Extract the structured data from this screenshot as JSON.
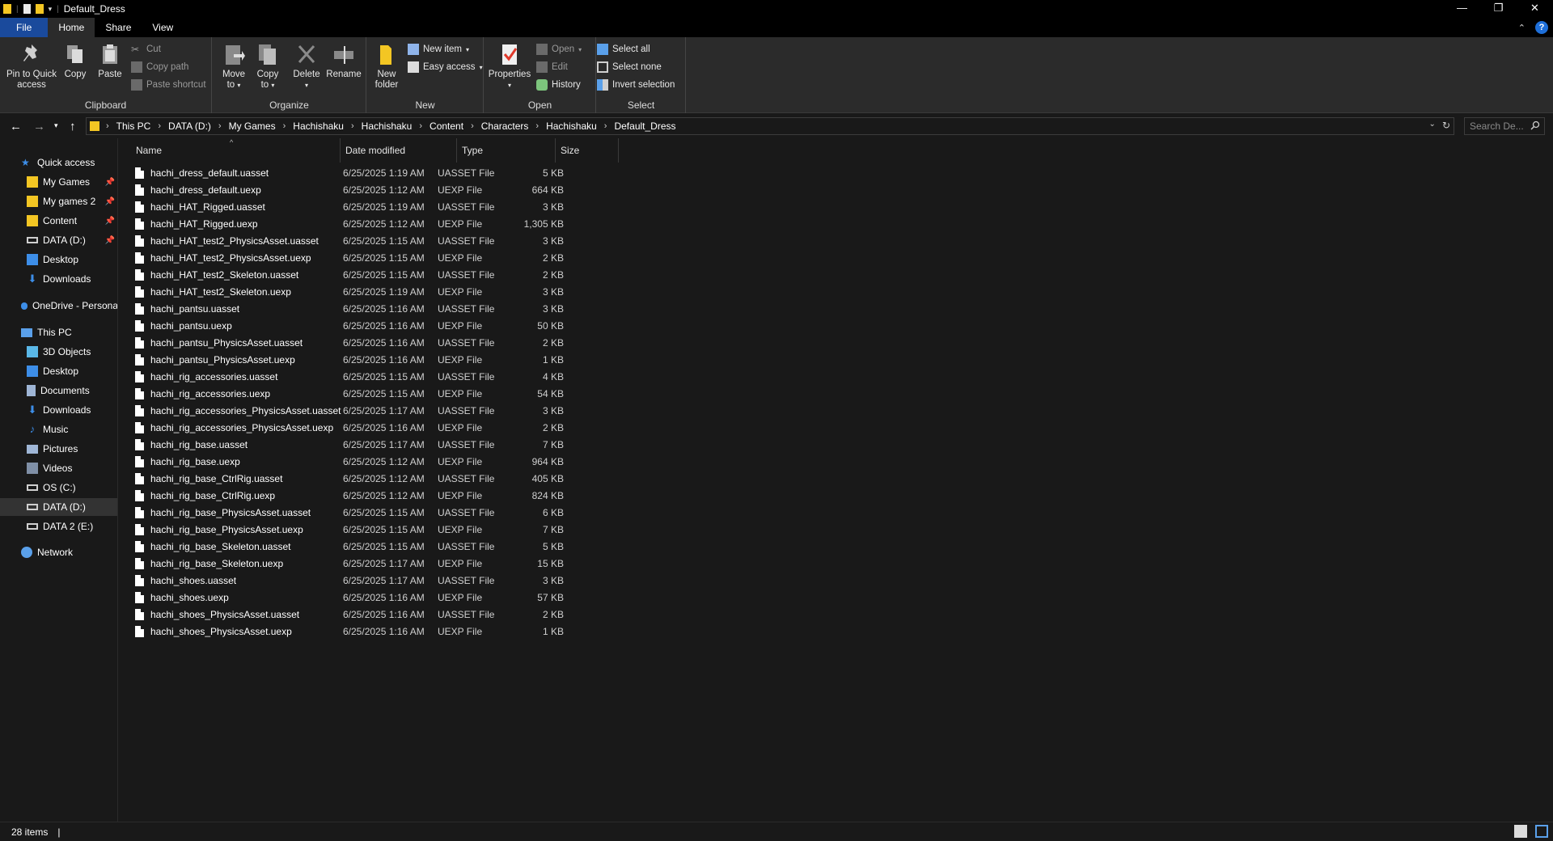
{
  "window": {
    "title": "Default_Dress",
    "minimize": "—",
    "restore": "❐",
    "close": "✕"
  },
  "ribbon_tabs": [
    "File",
    "Home",
    "Share",
    "View"
  ],
  "ribbon": {
    "clipboard": {
      "label": "Clipboard",
      "pin_label_1": "Pin to Quick",
      "pin_label_2": "access",
      "copy": "Copy",
      "paste": "Paste",
      "cut": "Cut",
      "copy_path": "Copy path",
      "paste_shortcut": "Paste shortcut"
    },
    "organize": {
      "label": "Organize",
      "move_to_1": "Move",
      "move_to_2": "to",
      "copy_to_1": "Copy",
      "copy_to_2": "to",
      "delete": "Delete",
      "rename": "Rename"
    },
    "new": {
      "label": "New",
      "new_folder_1": "New",
      "new_folder_2": "folder",
      "new_item": "New item",
      "easy_access": "Easy access"
    },
    "open": {
      "label": "Open",
      "properties": "Properties",
      "open": "Open",
      "edit": "Edit",
      "history": "History"
    },
    "select": {
      "label": "Select",
      "select_all": "Select all",
      "select_none": "Select none",
      "invert_selection": "Invert selection"
    }
  },
  "address": {
    "crumbs": [
      "This PC",
      "DATA (D:)",
      "My Games",
      "Hachishaku",
      "Hachishaku",
      "Content",
      "Characters",
      "Hachishaku",
      "Default_Dress"
    ],
    "search_placeholder": "Search De..."
  },
  "nav": {
    "quick_access": "Quick access",
    "pinned": [
      "My Games",
      "My games 2",
      "Content",
      "DATA (D:)"
    ],
    "recent": [
      "Desktop",
      "Downloads"
    ],
    "onedrive": "OneDrive - Persona",
    "this_pc": "This PC",
    "pc_items": [
      "3D Objects",
      "Desktop",
      "Documents",
      "Downloads",
      "Music",
      "Pictures",
      "Videos",
      "OS (C:)",
      "DATA (D:)",
      "DATA 2 (E:)"
    ],
    "network": "Network"
  },
  "columns": [
    "Name",
    "Date modified",
    "Type",
    "Size"
  ],
  "files": [
    {
      "name": "hachi_dress_default.uasset",
      "date": "6/25/2025 1:19 AM",
      "type": "UASSET File",
      "size": "5 KB"
    },
    {
      "name": "hachi_dress_default.uexp",
      "date": "6/25/2025 1:12 AM",
      "type": "UEXP File",
      "size": "664 KB"
    },
    {
      "name": "hachi_HAT_Rigged.uasset",
      "date": "6/25/2025 1:19 AM",
      "type": "UASSET File",
      "size": "3 KB"
    },
    {
      "name": "hachi_HAT_Rigged.uexp",
      "date": "6/25/2025 1:12 AM",
      "type": "UEXP File",
      "size": "1,305 KB"
    },
    {
      "name": "hachi_HAT_test2_PhysicsAsset.uasset",
      "date": "6/25/2025 1:15 AM",
      "type": "UASSET File",
      "size": "3 KB"
    },
    {
      "name": "hachi_HAT_test2_PhysicsAsset.uexp",
      "date": "6/25/2025 1:15 AM",
      "type": "UEXP File",
      "size": "2 KB"
    },
    {
      "name": "hachi_HAT_test2_Skeleton.uasset",
      "date": "6/25/2025 1:15 AM",
      "type": "UASSET File",
      "size": "2 KB"
    },
    {
      "name": "hachi_HAT_test2_Skeleton.uexp",
      "date": "6/25/2025 1:19 AM",
      "type": "UEXP File",
      "size": "3 KB"
    },
    {
      "name": "hachi_pantsu.uasset",
      "date": "6/25/2025 1:16 AM",
      "type": "UASSET File",
      "size": "3 KB"
    },
    {
      "name": "hachi_pantsu.uexp",
      "date": "6/25/2025 1:16 AM",
      "type": "UEXP File",
      "size": "50 KB"
    },
    {
      "name": "hachi_pantsu_PhysicsAsset.uasset",
      "date": "6/25/2025 1:16 AM",
      "type": "UASSET File",
      "size": "2 KB"
    },
    {
      "name": "hachi_pantsu_PhysicsAsset.uexp",
      "date": "6/25/2025 1:16 AM",
      "type": "UEXP File",
      "size": "1 KB"
    },
    {
      "name": "hachi_rig_accessories.uasset",
      "date": "6/25/2025 1:15 AM",
      "type": "UASSET File",
      "size": "4 KB"
    },
    {
      "name": "hachi_rig_accessories.uexp",
      "date": "6/25/2025 1:15 AM",
      "type": "UEXP File",
      "size": "54 KB"
    },
    {
      "name": "hachi_rig_accessories_PhysicsAsset.uasset",
      "date": "6/25/2025 1:17 AM",
      "type": "UASSET File",
      "size": "3 KB"
    },
    {
      "name": "hachi_rig_accessories_PhysicsAsset.uexp",
      "date": "6/25/2025 1:16 AM",
      "type": "UEXP File",
      "size": "2 KB"
    },
    {
      "name": "hachi_rig_base.uasset",
      "date": "6/25/2025 1:17 AM",
      "type": "UASSET File",
      "size": "7 KB"
    },
    {
      "name": "hachi_rig_base.uexp",
      "date": "6/25/2025 1:12 AM",
      "type": "UEXP File",
      "size": "964 KB"
    },
    {
      "name": "hachi_rig_base_CtrlRig.uasset",
      "date": "6/25/2025 1:12 AM",
      "type": "UASSET File",
      "size": "405 KB"
    },
    {
      "name": "hachi_rig_base_CtrlRig.uexp",
      "date": "6/25/2025 1:12 AM",
      "type": "UEXP File",
      "size": "824 KB"
    },
    {
      "name": "hachi_rig_base_PhysicsAsset.uasset",
      "date": "6/25/2025 1:15 AM",
      "type": "UASSET File",
      "size": "6 KB"
    },
    {
      "name": "hachi_rig_base_PhysicsAsset.uexp",
      "date": "6/25/2025 1:15 AM",
      "type": "UEXP File",
      "size": "7 KB"
    },
    {
      "name": "hachi_rig_base_Skeleton.uasset",
      "date": "6/25/2025 1:15 AM",
      "type": "UASSET File",
      "size": "5 KB"
    },
    {
      "name": "hachi_rig_base_Skeleton.uexp",
      "date": "6/25/2025 1:17 AM",
      "type": "UEXP File",
      "size": "15 KB"
    },
    {
      "name": "hachi_shoes.uasset",
      "date": "6/25/2025 1:17 AM",
      "type": "UASSET File",
      "size": "3 KB"
    },
    {
      "name": "hachi_shoes.uexp",
      "date": "6/25/2025 1:16 AM",
      "type": "UEXP File",
      "size": "57 KB"
    },
    {
      "name": "hachi_shoes_PhysicsAsset.uasset",
      "date": "6/25/2025 1:16 AM",
      "type": "UASSET File",
      "size": "2 KB"
    },
    {
      "name": "hachi_shoes_PhysicsAsset.uexp",
      "date": "6/25/2025 1:16 AM",
      "type": "UEXP File",
      "size": "1 KB"
    }
  ],
  "status": {
    "item_count": "28 items",
    "separator": "|"
  },
  "colors": {
    "file_tab": "#1a4a9c",
    "folder": "#f3c623",
    "accent_blue": "#1e6fd9"
  }
}
